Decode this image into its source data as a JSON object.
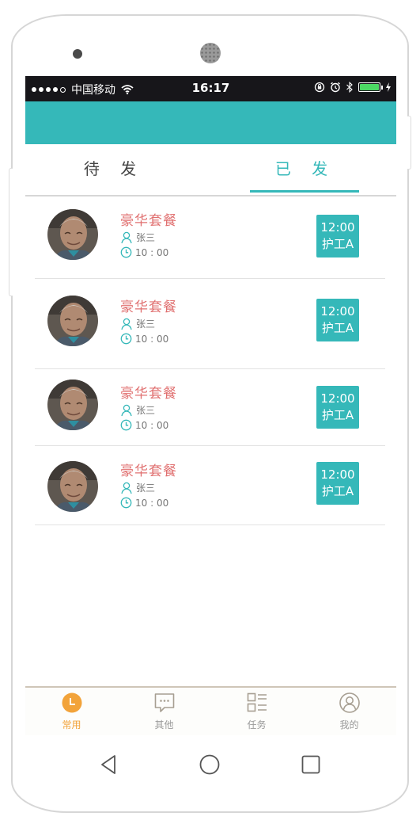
{
  "status_bar": {
    "carrier": "中国移动",
    "time": "16:17"
  },
  "tabs": {
    "left_label": "待 发",
    "right_label": "已 发",
    "active": "right"
  },
  "list": [
    {
      "title": "豪华套餐",
      "name": "张三",
      "time": "10 : 00",
      "badge_time": "12:00",
      "badge_worker": "护工A"
    },
    {
      "title": "豪华套餐",
      "name": "张三",
      "time": "10 : 00",
      "badge_time": "12:00",
      "badge_worker": "护工A"
    },
    {
      "title": "豪华套餐",
      "name": "张三",
      "time": "10 : 00",
      "badge_time": "12:00",
      "badge_worker": "护工A"
    },
    {
      "title": "豪华套餐",
      "name": "张三",
      "time": "10 : 00",
      "badge_time": "12:00",
      "badge_worker": "护工A"
    }
  ],
  "tabbar": [
    {
      "label": "常用",
      "icon": "clock-icon",
      "active": true
    },
    {
      "label": "其他",
      "icon": "chat-icon",
      "active": false
    },
    {
      "label": "任务",
      "icon": "task-list-icon",
      "active": false
    },
    {
      "label": "我的",
      "icon": "user-icon",
      "active": false
    }
  ],
  "colors": {
    "accent": "#35b8b9",
    "title": "#e07070",
    "tab_active": "#f2a33a",
    "status_bar": "#17161a"
  }
}
